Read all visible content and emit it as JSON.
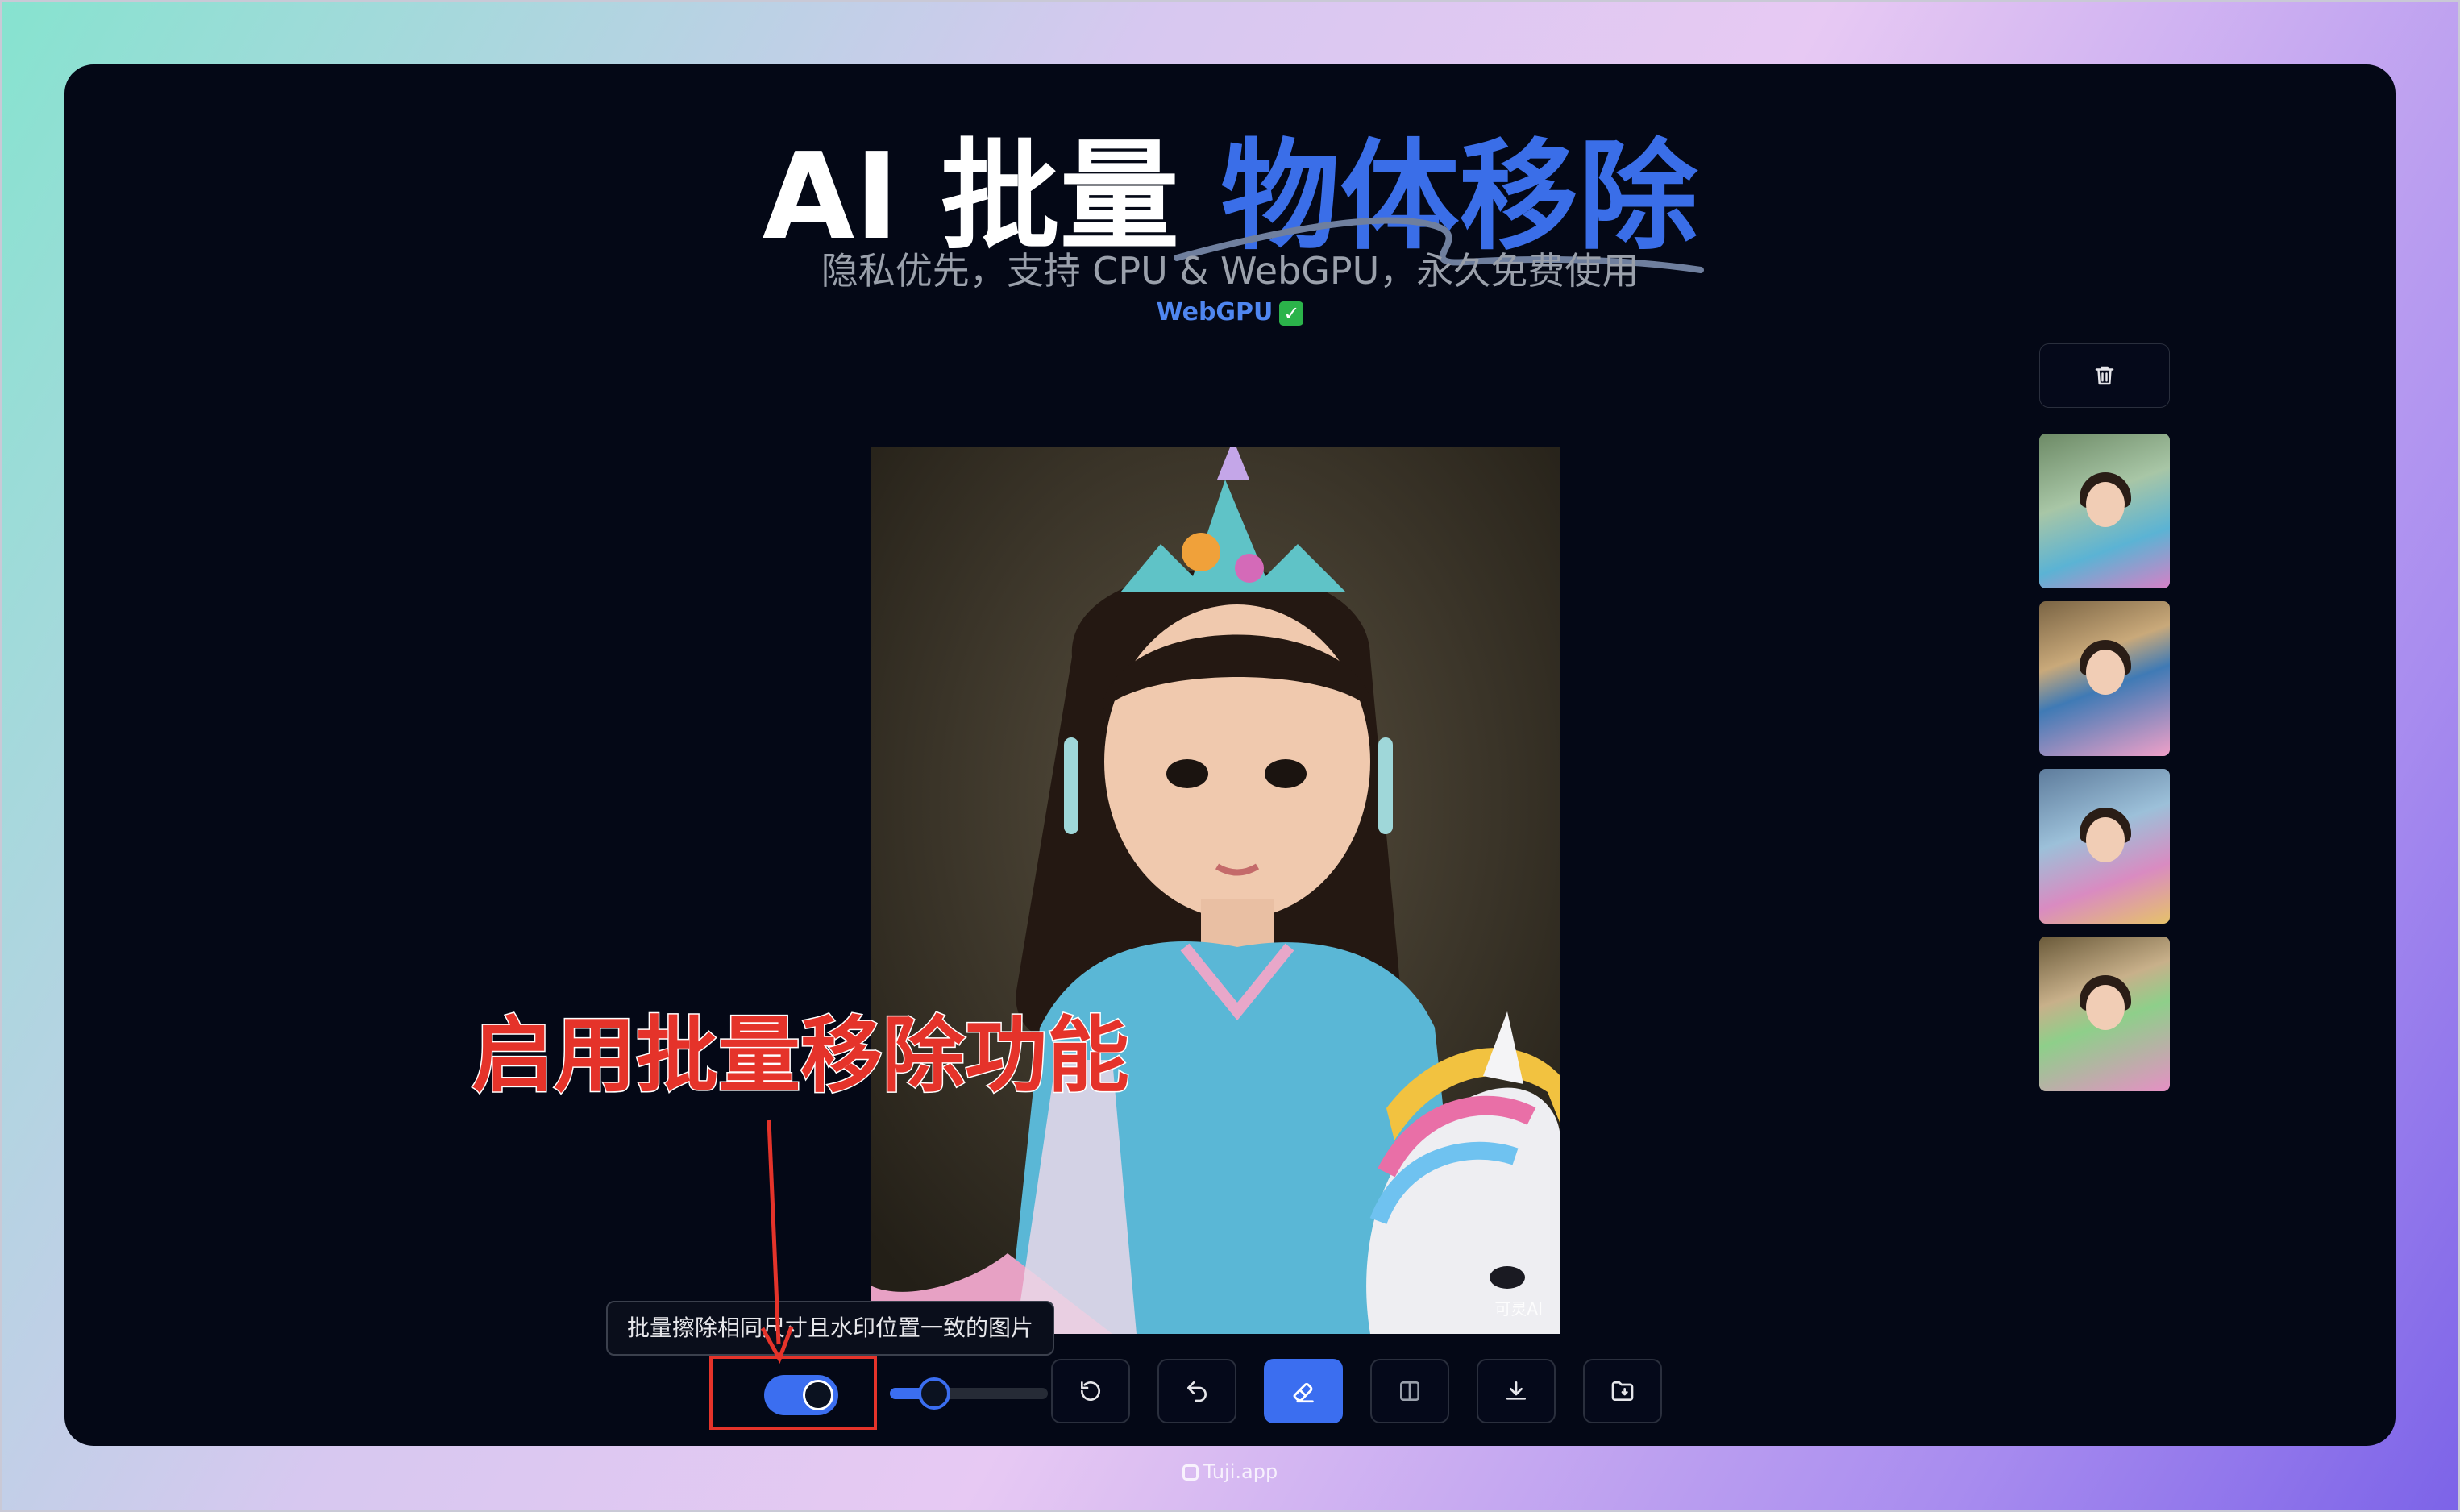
{
  "header": {
    "title_plain": "AI 批量 ",
    "title_highlight": "物体移除",
    "subtitle": "隐私优先，支持 CPU & WebGPU，永久免费使用",
    "backend_label": "WebGPU"
  },
  "main_image": {
    "watermark": "可灵AI"
  },
  "sidebar": {
    "trash_icon": "trash-icon",
    "thumbnails": [
      {
        "name": "thumbnail-1"
      },
      {
        "name": "thumbnail-2"
      },
      {
        "name": "thumbnail-3"
      },
      {
        "name": "thumbnail-4"
      }
    ]
  },
  "annotation": {
    "text": "启用批量移除功能",
    "color": "#e5332a"
  },
  "toolbar": {
    "batch_toggle_on": true,
    "batch_tooltip": "批量擦除相同尺寸且水印位置一致的图片",
    "brush_size_level": 0.28,
    "buttons": [
      {
        "name": "reset-button",
        "icon": "reset-icon"
      },
      {
        "name": "undo-button",
        "icon": "undo-icon"
      },
      {
        "name": "eraser-button",
        "icon": "eraser-icon",
        "active": true
      },
      {
        "name": "compare-button",
        "icon": "compare-icon"
      },
      {
        "name": "download-button",
        "icon": "download-icon"
      },
      {
        "name": "save-to-folder-button",
        "icon": "folder-save-icon"
      }
    ],
    "accent_color": "#3b6ef0"
  },
  "footer": {
    "brand": "Tuji.app"
  }
}
